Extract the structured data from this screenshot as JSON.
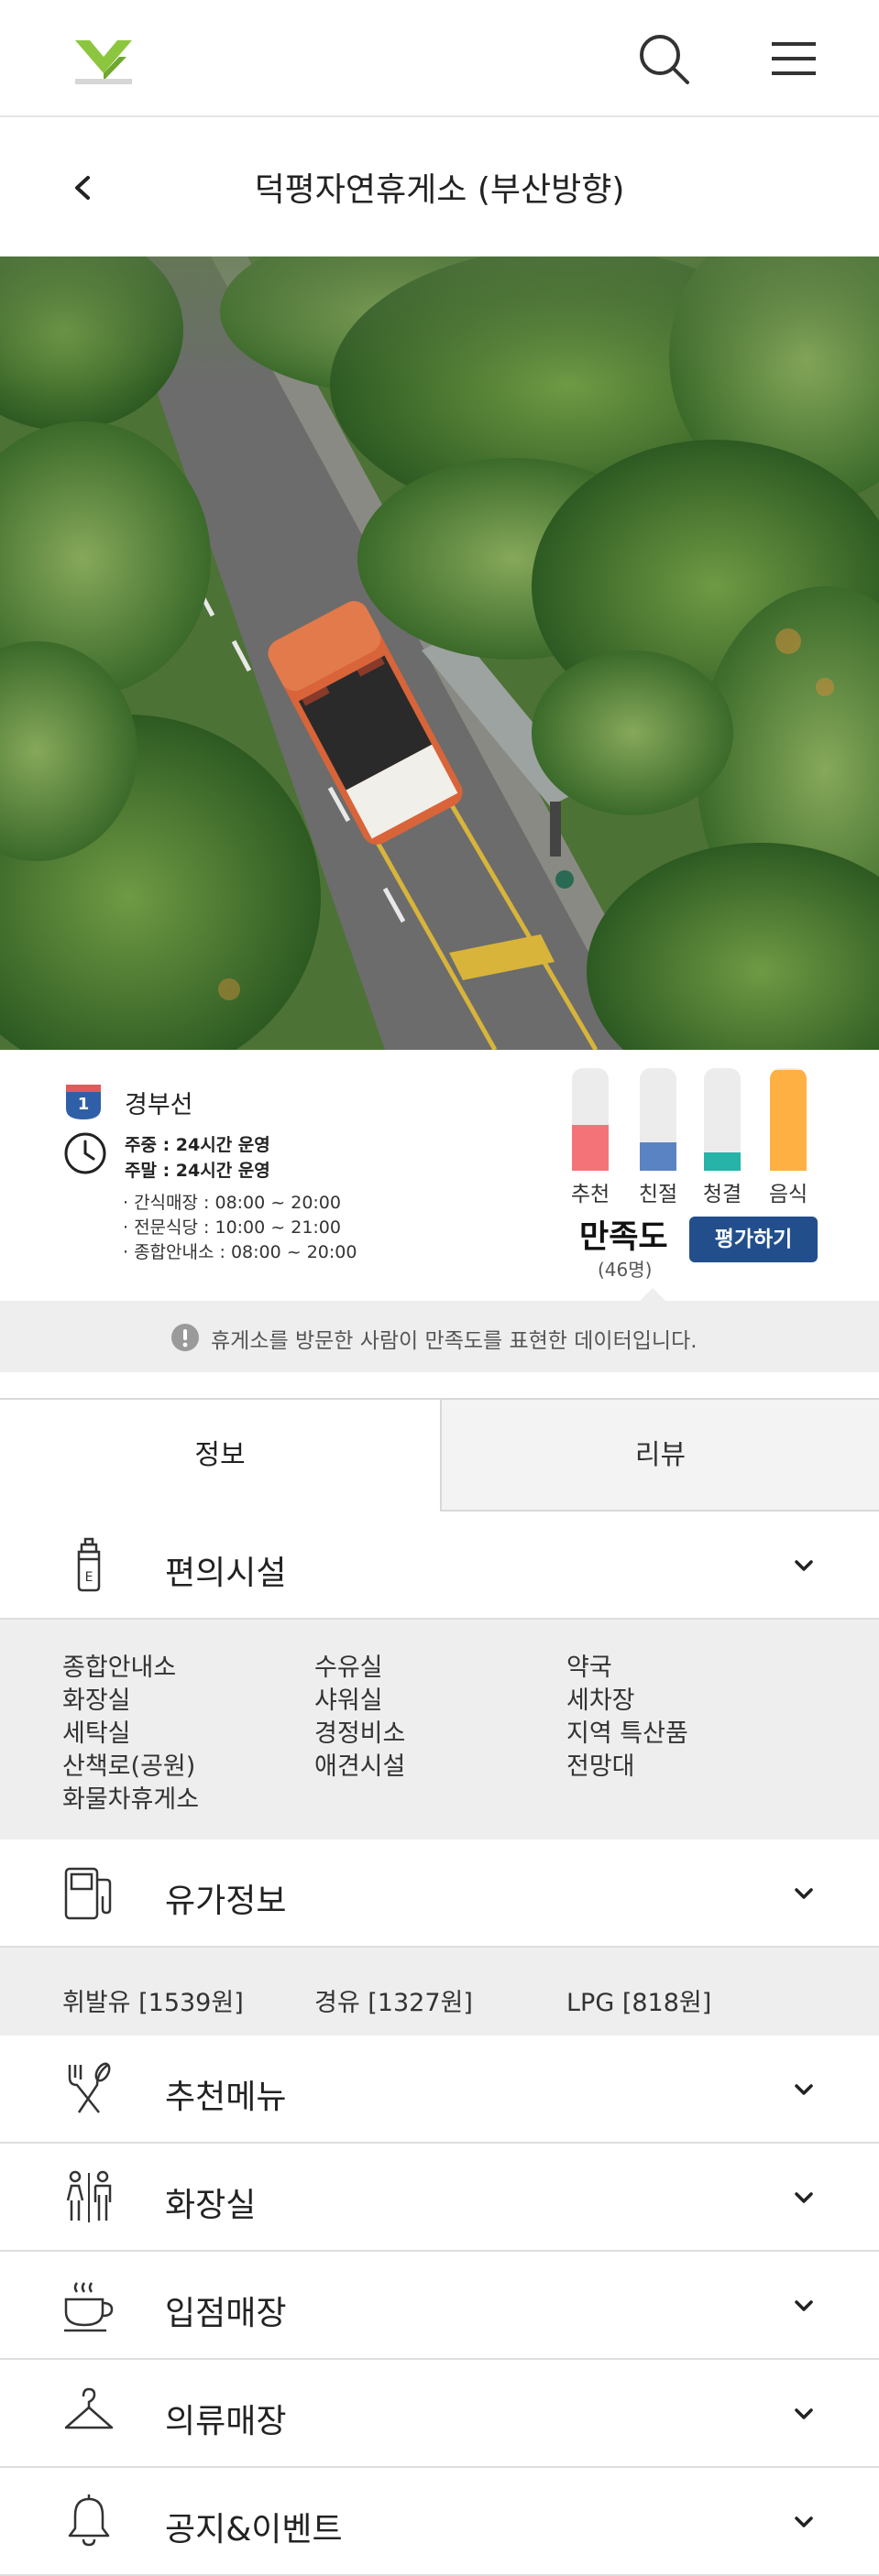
{
  "header": {
    "logo_name": "logo",
    "search_icon": "search-icon",
    "menu_icon": "hamburger-menu-icon"
  },
  "subheader": {
    "back_icon": "chevron-left-icon",
    "title": "덕평자연휴게소 (부산방향)"
  },
  "hero": {
    "image_name": "bus-on-tree-lined-road-photo"
  },
  "info": {
    "route_number": "1",
    "route_name": "경부선",
    "hours": {
      "weekday": "주중 : 24시간 운영",
      "weekend": "주말 : 24시간 운영"
    },
    "facility_hours": [
      "· 간식매장 : 08:00 ~ 20:00",
      "· 전문식당 : 10:00 ~ 21:00",
      "· 종합안내소 : 08:00 ~ 20:00"
    ],
    "ratings": [
      {
        "label": "추천",
        "level": 0.45,
        "color": "#f47379"
      },
      {
        "label": "친절",
        "level": 0.28,
        "color": "#5a83c3"
      },
      {
        "label": "청결",
        "level": 0.18,
        "color": "#26b3a8"
      },
      {
        "label": "음식",
        "level": 0.98,
        "color": "#ffb042"
      }
    ],
    "satisfaction_label": "만족도",
    "satisfaction_count": "(46명)",
    "rate_button": "평가하기"
  },
  "notice": {
    "text": "휴게소를 방문한 사람이 만족도를 표현한 데이터입니다."
  },
  "tabs": [
    {
      "label": "정보",
      "active": true
    },
    {
      "label": "리뷰",
      "active": false
    }
  ],
  "sections": {
    "convenience": {
      "label": "편의시설",
      "icon": "convenience-store-icon",
      "items": [
        "종합안내소",
        "수유실",
        "약국",
        "화장실",
        "샤워실",
        "세차장",
        "세탁실",
        "경정비소",
        "지역 특산품",
        "산책로(공원)",
        "애견시설",
        "전망대",
        "화물차휴게소"
      ]
    },
    "fuel": {
      "label": "유가정보",
      "icon": "gas-pump-icon",
      "items": [
        "휘발유 [1539원]",
        "경유 [1327원]",
        "LPG [818원]"
      ]
    },
    "menu": {
      "label": "추천메뉴",
      "icon": "fork-knife-icon"
    },
    "restroom": {
      "label": "화장실",
      "icon": "restroom-icon"
    },
    "stores": {
      "label": "입점매장",
      "icon": "coffee-cup-icon"
    },
    "clothing": {
      "label": "의류매장",
      "icon": "hanger-icon"
    },
    "notices": {
      "label": "공지&이벤트",
      "icon": "bell-icon"
    }
  }
}
